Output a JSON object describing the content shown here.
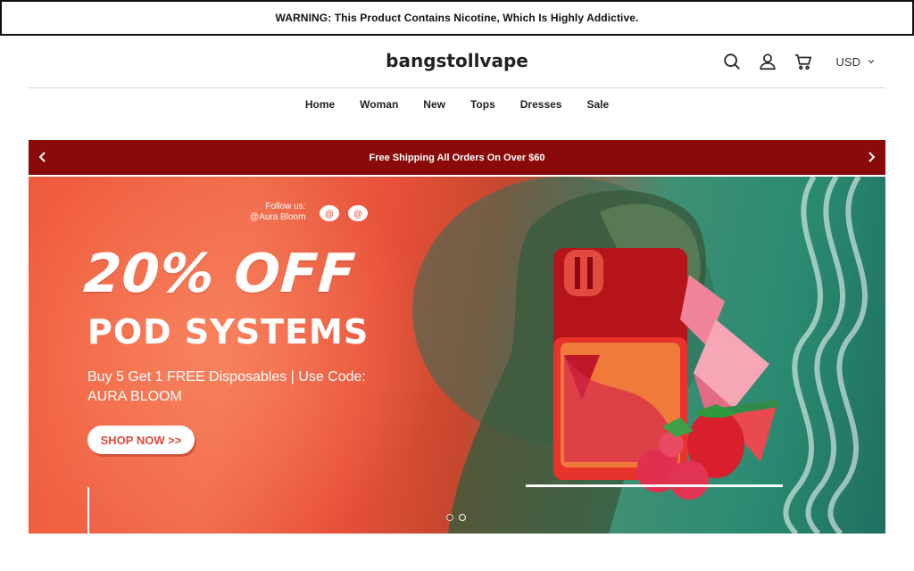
{
  "warning": {
    "text": "WARNING: This Product Contains Nicotine, Which Is Highly Addictive."
  },
  "header": {
    "brand": "bangstollvape",
    "currency": "USD",
    "icons": [
      "search-icon",
      "account-icon",
      "cart-icon",
      "chevron-down-icon"
    ]
  },
  "nav": {
    "items": [
      "Home",
      "Woman",
      "New",
      "Tops",
      "Dresses",
      "Sale"
    ]
  },
  "promo": {
    "text": "Free Shipping All Orders On Over $60",
    "background": "#8a0a0a"
  },
  "hero": {
    "follow_line1": "Follow us:",
    "follow_line2": "@Aura Bloom",
    "headline": "20% OFF",
    "subheadline": "POD SYSTEMS",
    "offer": "Buy 5 Get 1 FREE Disposables | Use Code: AURA BLOOM",
    "cta": "SHOP NOW >>",
    "slides": 2,
    "active_slide": 1,
    "accent": "#e0483a"
  }
}
